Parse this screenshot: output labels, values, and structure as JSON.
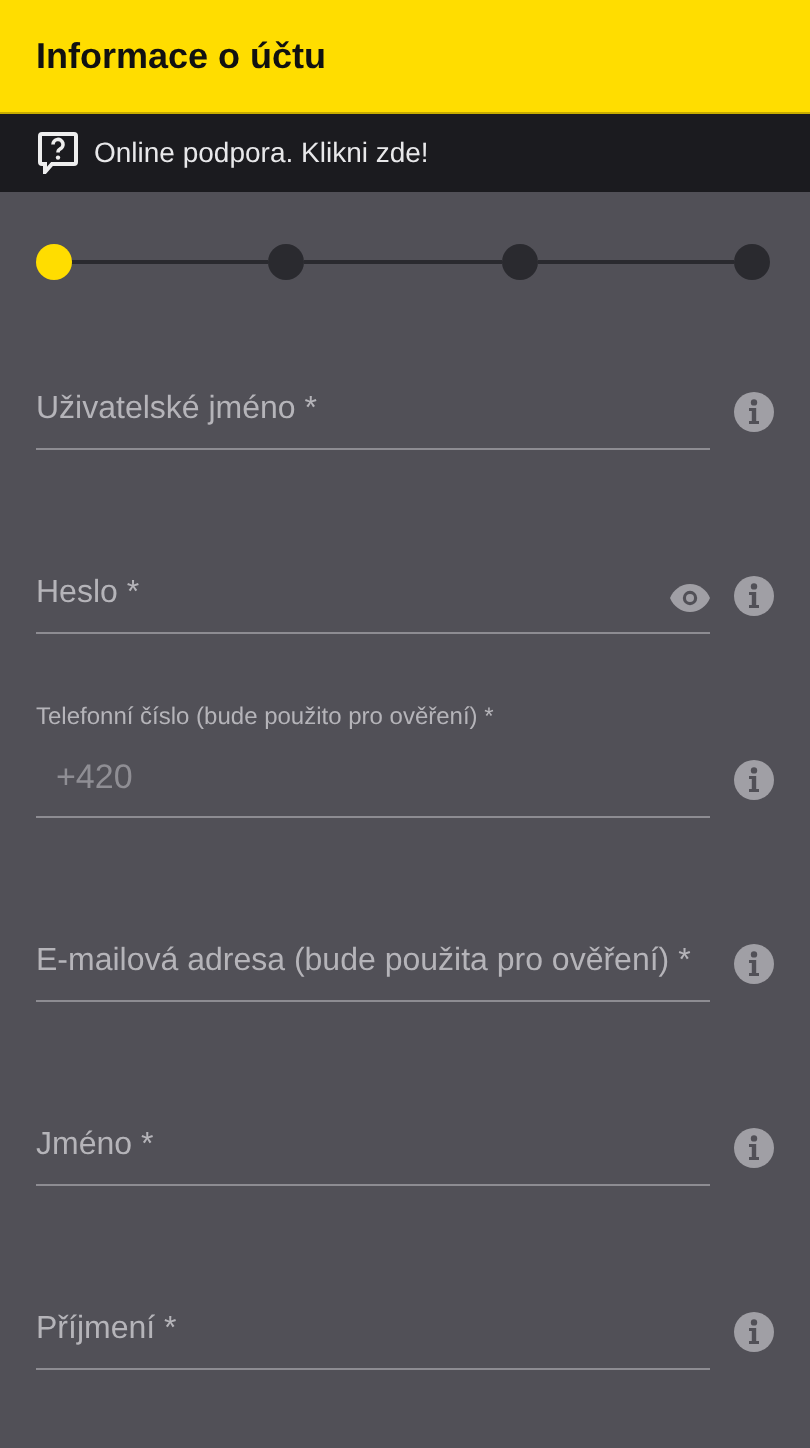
{
  "header": {
    "title": "Informace o účtu"
  },
  "support_bar": {
    "text": "Online podpora. Klikni zde!"
  },
  "steps": [
    {
      "selected": true
    },
    {
      "selected": false
    },
    {
      "selected": false
    },
    {
      "selected": false
    }
  ],
  "fields": [
    {
      "kind": "text",
      "label": "Uživatelské jméno *"
    },
    {
      "kind": "password",
      "label": "Heslo *"
    },
    {
      "kind": "filled",
      "label": "Telefonní číslo (bude použito pro ověření) *",
      "value": "+420"
    },
    {
      "kind": "text",
      "label": "E-mailová adresa (bude použita pro ověření) *"
    },
    {
      "kind": "text",
      "label": "Jméno *"
    },
    {
      "kind": "text",
      "label": "Příjmení *"
    }
  ]
}
